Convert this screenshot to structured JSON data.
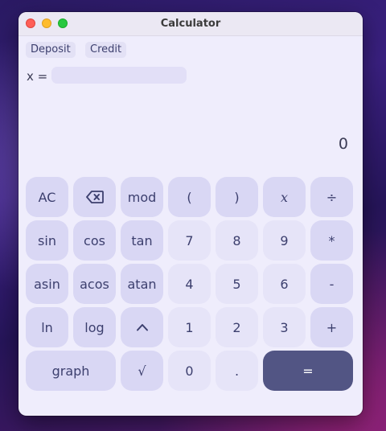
{
  "window": {
    "title": "Calculator"
  },
  "modes": {
    "deposit": "Deposit",
    "credit": "Credit"
  },
  "variable": {
    "label": "x =",
    "value": "",
    "placeholder": ""
  },
  "display": {
    "value": "0"
  },
  "keypad": {
    "rows": [
      [
        "AC",
        "⌫",
        "mod",
        "(",
        ")",
        "x",
        "÷"
      ],
      [
        "sin",
        "cos",
        "tan",
        "7",
        "8",
        "9",
        "*"
      ],
      [
        "asin",
        "acos",
        "atan",
        "4",
        "5",
        "6",
        "-"
      ],
      [
        "ln",
        "log",
        "^",
        "1",
        "2",
        "3",
        "+"
      ],
      [
        "graph",
        "√",
        "0",
        ".",
        "="
      ]
    ]
  },
  "colors": {
    "window_bg": "#efedfc",
    "key_function": "#d9d7f4",
    "key_digit": "#e6e4f8",
    "key_equals": "#525584",
    "key_text": "#3c3f6e"
  }
}
